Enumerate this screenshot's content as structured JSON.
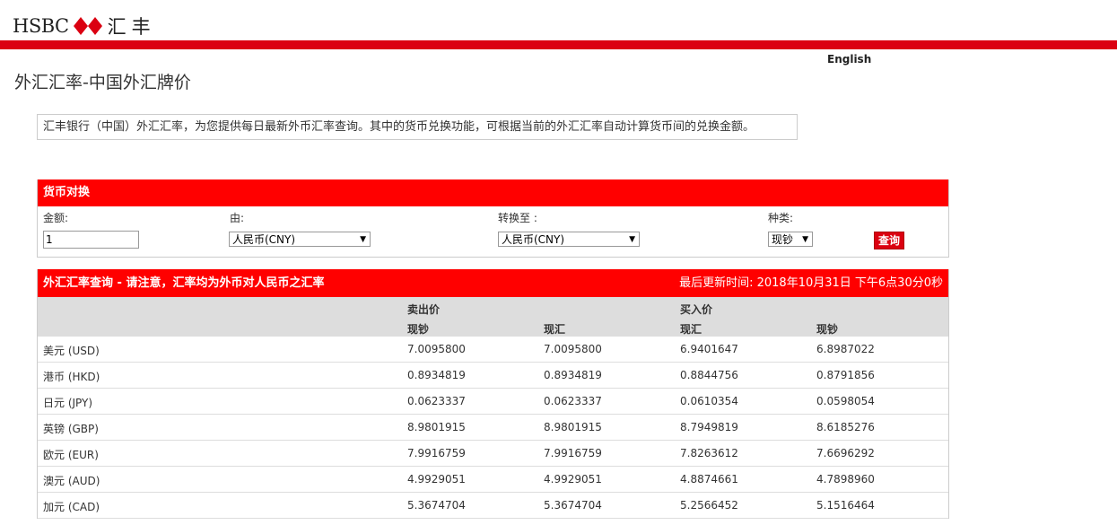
{
  "header": {
    "brand": "HSBC",
    "brand_cn": "汇丰",
    "brand_colors": {
      "red": "#db0011",
      "white": "#ffffff"
    },
    "language_link": "English"
  },
  "page_title": "外汇汇率-中国外汇牌价",
  "intro_text": "汇丰银行（中国）外汇汇率，为您提供每日最新外币汇率查询。其中的货币兑换功能，可根据当前的外汇汇率自动计算货币间的兑换金额。",
  "converter": {
    "title": "货币对换",
    "amount_label": "金额:",
    "amount_value": "1",
    "from_label": "由:",
    "from_value": "人民币(CNY)",
    "to_label": "转换至 :",
    "to_value": "人民币(CNY)",
    "type_label": "种类:",
    "type_value": "现钞",
    "submit_label": "查询"
  },
  "rates": {
    "title": "外汇汇率查询 - 请注意，汇率均为外币对人民币之汇率",
    "last_updated": "最后更新时间:  2018年10月31日 下午6点30分0秒",
    "group_sell": "卖出价",
    "group_buy": "买入价",
    "col_headers": [
      "现钞",
      "现汇",
      "现汇",
      "现钞"
    ],
    "rows": [
      {
        "currency": "美元 (USD)",
        "sell_cash": "7.0095800",
        "sell_transfer": "7.0095800",
        "buy_transfer": "6.9401647",
        "buy_cash": "6.8987022"
      },
      {
        "currency": "港币 (HKD)",
        "sell_cash": "0.8934819",
        "sell_transfer": "0.8934819",
        "buy_transfer": "0.8844756",
        "buy_cash": "0.8791856"
      },
      {
        "currency": "日元 (JPY)",
        "sell_cash": "0.0623337",
        "sell_transfer": "0.0623337",
        "buy_transfer": "0.0610354",
        "buy_cash": "0.0598054"
      },
      {
        "currency": "英镑 (GBP)",
        "sell_cash": "8.9801915",
        "sell_transfer": "8.9801915",
        "buy_transfer": "8.7949819",
        "buy_cash": "8.6185276"
      },
      {
        "currency": "欧元 (EUR)",
        "sell_cash": "7.9916759",
        "sell_transfer": "7.9916759",
        "buy_transfer": "7.8263612",
        "buy_cash": "7.6696292"
      },
      {
        "currency": "澳元 (AUD)",
        "sell_cash": "4.9929051",
        "sell_transfer": "4.9929051",
        "buy_transfer": "4.8874661",
        "buy_cash": "4.7898960"
      },
      {
        "currency": "加元 (CAD)",
        "sell_cash": "5.3674704",
        "sell_transfer": "5.3674704",
        "buy_transfer": "5.2566452",
        "buy_cash": "5.1516464"
      }
    ]
  }
}
